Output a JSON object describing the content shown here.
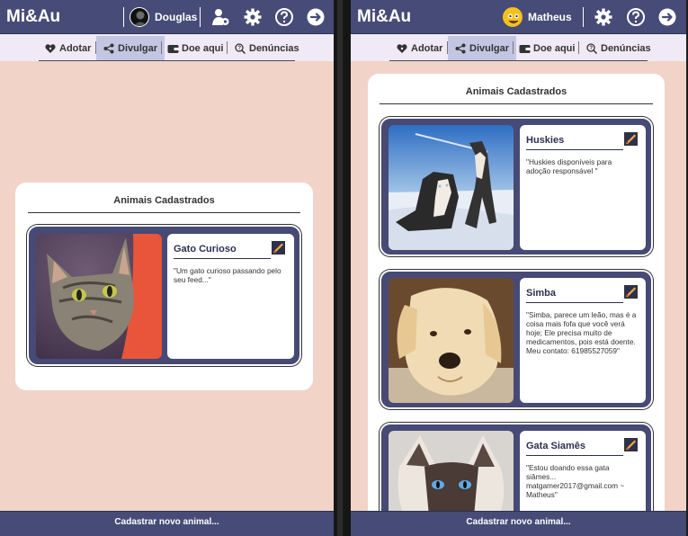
{
  "app": {
    "brand": "Mi&Au"
  },
  "left": {
    "user": "Douglas",
    "panel_title": "Animais Cadastrados",
    "cards": [
      {
        "name": "Gato Curioso",
        "desc": "\"Um gato curioso passando pelo seu feed...\""
      }
    ]
  },
  "right": {
    "user": "Matheus",
    "panel_title": "Animais Cadastrados",
    "cards": [
      {
        "name": "Huskies",
        "desc": "\"Huskies disponíveis para adoção responsável \""
      },
      {
        "name": "Simba",
        "desc": "\"Simba, parece um leão, mas é a coisa mais fofa que você verá hoje; Ele precisa muito de medicamentos, pois está doente. Meu contato: 61985527059\""
      },
      {
        "name": "Gata Siamês",
        "desc": "\"Estou doando essa gata siâmes... matgamer2017@gmail.com ~ Matheus\""
      }
    ]
  },
  "tabs": [
    {
      "label": "Adotar",
      "icon": "heart-paw-icon"
    },
    {
      "label": "Divulgar",
      "icon": "share-icon",
      "active": true
    },
    {
      "label": "Doe aqui",
      "icon": "wallet-icon"
    },
    {
      "label": "Denúncias",
      "icon": "help-search-icon"
    }
  ],
  "topbar_icons": [
    "user-settings-icon",
    "gear-icon",
    "help-icon",
    "logout-icon"
  ],
  "footer": {
    "label": "Cadastrar novo animal..."
  },
  "colors": {
    "header": "#474b77",
    "background": "#f1d3c8",
    "tab_active": "#c3c6e3",
    "tabbar": "#efeaf5"
  }
}
